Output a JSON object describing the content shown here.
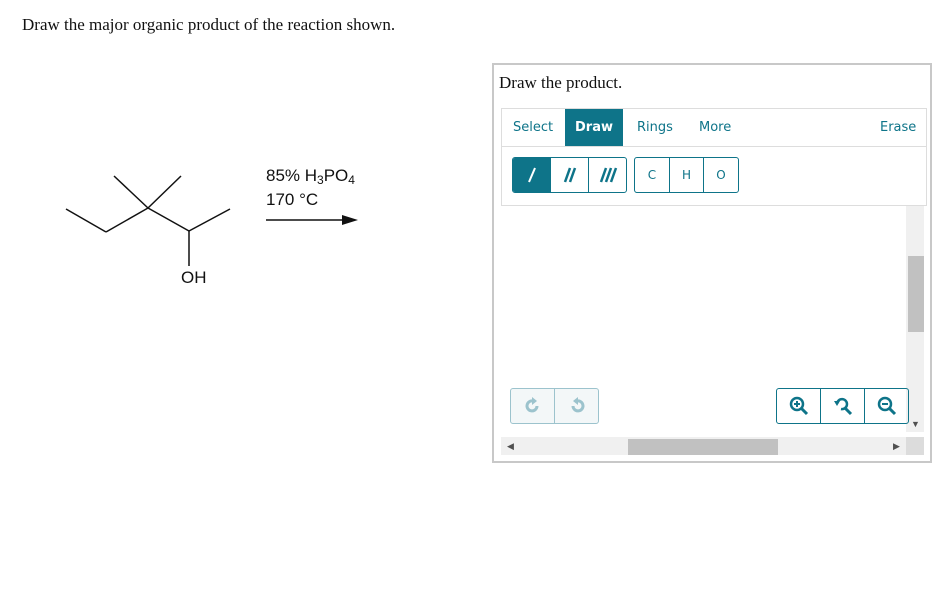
{
  "question": "Draw the major organic product of the reaction shown.",
  "reaction": {
    "reagent_line1_prefix": "85% H",
    "reagent_sub1": "3",
    "reagent_mid": "PO",
    "reagent_sub2": "4",
    "condition_line2": "170 °C",
    "hydroxyl_label": "OH"
  },
  "panel": {
    "title": "Draw the product.",
    "tabs": [
      {
        "label": "Select",
        "active": false
      },
      {
        "label": "Draw",
        "active": true
      },
      {
        "label": "Rings",
        "active": false
      },
      {
        "label": "More",
        "active": false
      },
      {
        "label": "Erase",
        "active": false
      }
    ],
    "bond_buttons": [
      "single-bond",
      "double-bond",
      "triple-bond"
    ],
    "atom_buttons": [
      "C",
      "H",
      "O"
    ],
    "undo_buttons": [
      "undo",
      "redo"
    ],
    "zoom_buttons": [
      "zoom-in",
      "zoom-reset",
      "zoom-out"
    ]
  },
  "colors": {
    "accent": "#0e7489",
    "disabled": "#9cc3cd"
  }
}
